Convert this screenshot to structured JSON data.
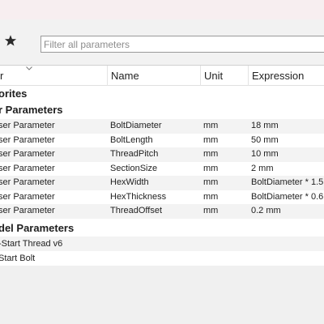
{
  "filter": {
    "placeholder": "Filter all parameters"
  },
  "columns": {
    "col1": "r",
    "name": "Name",
    "unit": "Unit",
    "expression": "Expression"
  },
  "groups": {
    "favorites": "orites",
    "user_parameters": "r Parameters",
    "model_parameters": "del Parameters"
  },
  "user_params": [
    {
      "type": "ser Parameter",
      "name": "BoltDiameter",
      "unit": "mm",
      "expression": "18 mm"
    },
    {
      "type": "ser Parameter",
      "name": "BoltLength",
      "unit": "mm",
      "expression": "50 mm"
    },
    {
      "type": "ser Parameter",
      "name": "ThreadPitch",
      "unit": "mm",
      "expression": "10 mm"
    },
    {
      "type": "ser Parameter",
      "name": "SectionSize",
      "unit": "mm",
      "expression": "2 mm"
    },
    {
      "type": "ser Parameter",
      "name": "HexWidth",
      "unit": "mm",
      "expression": "BoltDiameter * 1.5"
    },
    {
      "type": "ser Parameter",
      "name": "HexThickness",
      "unit": "mm",
      "expression": "BoltDiameter * 0.6"
    },
    {
      "type": "ser Parameter",
      "name": "ThreadOffset",
      "unit": "mm",
      "expression": "0.2 mm"
    }
  ],
  "models": [
    {
      "label": "-Start Thread v6"
    },
    {
      "label": " Start Bolt"
    }
  ],
  "icons": {
    "favorites": "star-icon",
    "sort": "sort-caret-icon"
  }
}
